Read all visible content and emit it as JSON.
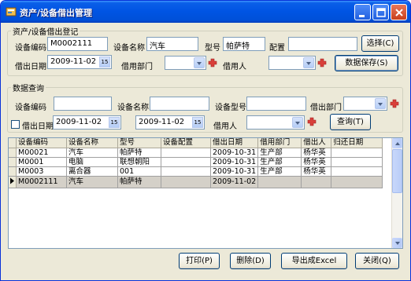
{
  "window": {
    "title": "资产/设备借出管理"
  },
  "register": {
    "legend": "资产/设备借出登记",
    "code_label": "设备编码",
    "code_value": "M0002111",
    "name_label": "设备名称",
    "name_value": "汽车",
    "model_label": "型号",
    "model_value": "帕萨特",
    "config_label": "配置",
    "config_value": "",
    "select_button": "选择(C)",
    "date_label": "借出日期",
    "date_value": "2009-11-02",
    "dept_label": "借用部门",
    "dept_value": "",
    "person_label": "借用人",
    "person_value": "",
    "save_button": "数据保存(S)"
  },
  "query": {
    "legend": "数据查询",
    "code_label": "设备编码",
    "name_label": "设备名称",
    "model_label": "设备型号",
    "dept_label": "借出部门",
    "date_label": "借出日期",
    "date_from": "2009-11-02",
    "date_to": "2009-11-02",
    "person_label": "借用人",
    "query_button": "查询(T)"
  },
  "table": {
    "columns": [
      "设备编码",
      "设备名称",
      "型号",
      "设备配置",
      "借出日期",
      "借用部门",
      "借出人",
      "归还日期"
    ],
    "rows": [
      [
        "M00021",
        "汽车",
        "帕萨特",
        "",
        "2009-10-31",
        "生产部",
        "杨华英",
        ""
      ],
      [
        "M0001",
        "电脑",
        "联想朝阳",
        "",
        "2009-10-31",
        "生产部",
        "杨华英",
        ""
      ],
      [
        "M0003",
        "离合器",
        "001",
        "",
        "2009-10-31",
        "生产部",
        "杨华英",
        ""
      ],
      [
        "M0002111",
        "汽车",
        "帕萨特",
        "",
        "2009-11-02",
        "",
        "",
        ""
      ]
    ]
  },
  "footer": {
    "print_button": "打印(P)",
    "delete_button": "删除(D)",
    "export_button": "导出成Excel",
    "close_button": "关闭(Q)"
  },
  "colors": {
    "titlebar": "#0054e3",
    "window_bg": "#ece9d8",
    "plus_icon": "#d9403a"
  }
}
